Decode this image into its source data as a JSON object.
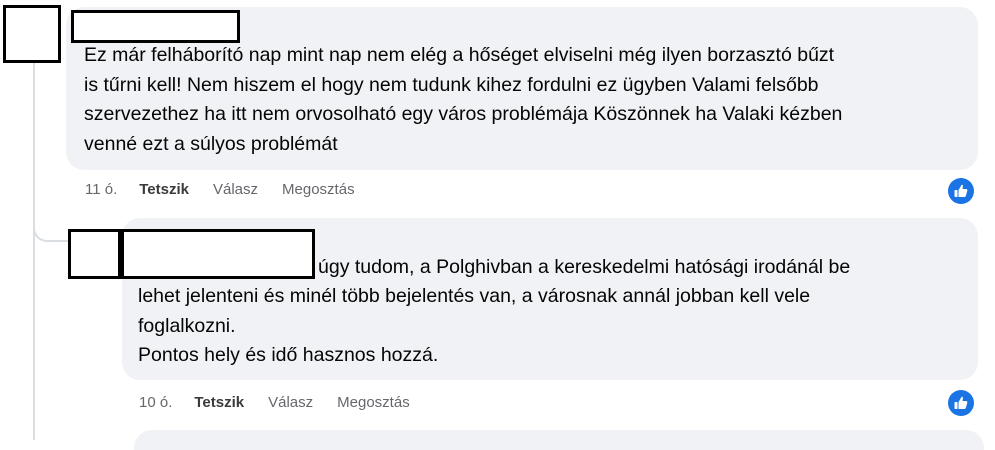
{
  "comments": [
    {
      "text": "Ez már felháborító nap mint nap nem elég a hőséget elviselni még ilyen borzasztó bűzt\nis tűrni kell! Nem hiszem el hogy nem tudunk kihez fordulni ez ügyben Valami felsőbb\nszervezethez ha itt nem orvosolható egy város problémája Köszönnek ha Valaki kézben\nvenné ezt a súlyos problémát",
      "time": "11 ó.",
      "like": "Tetszik",
      "reply": "Válasz",
      "share": "Megosztás",
      "reaction_icon": "thumbs-up-icon"
    },
    {
      "first_line": "úgy tudom, a Polghivban a kereskedelmi hatósági irodánál be",
      "text": "lehet jelenteni és minél több bejelentés van, a városnak annál jobban kell vele\nfoglalkozni.\nPontos hely és idő hasznos hozzá.",
      "time": "10 ó.",
      "like": "Tetszik",
      "reply": "Válasz",
      "share": "Megosztás",
      "reaction_icon": "thumbs-up-icon"
    }
  ],
  "colors": {
    "bubble": "#f0f2f5",
    "meta_text": "#65676b",
    "like_badge": "#1b74e4"
  }
}
